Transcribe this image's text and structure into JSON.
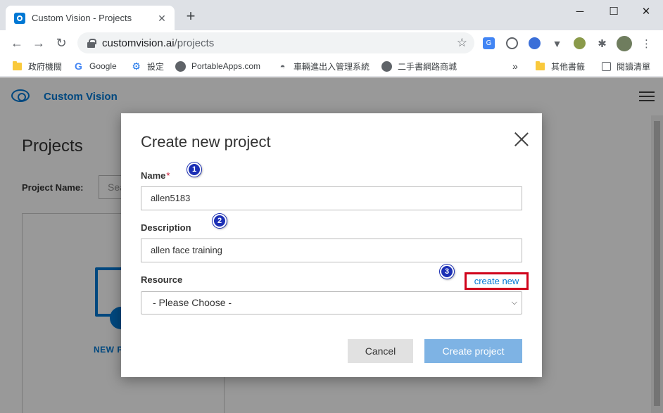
{
  "browser": {
    "tab_title": "Custom Vision - Projects",
    "tab_close_glyph": "✕",
    "new_tab_glyph": "+",
    "window_controls": {
      "minimize": "─",
      "maximize": "☐",
      "close": "✕"
    },
    "url_host": "customvision.ai",
    "url_path": "/projects",
    "nav": {
      "back": "←",
      "forward": "→",
      "reload": "↻"
    },
    "star_glyph": "☆",
    "extensions": [
      "translate-icon",
      "chat-icon",
      "compass-icon",
      "vee-icon",
      "leaf-icon",
      "puzzle-icon",
      "avatar",
      "menu-dots-icon"
    ],
    "bookmarks": [
      {
        "label": "政府機關",
        "icon": "folder-icon"
      },
      {
        "label": "Google",
        "icon": "google-icon"
      },
      {
        "label": "設定",
        "icon": "gear-icon"
      },
      {
        "label": "PortableApps.com",
        "icon": "portableapps-icon"
      },
      {
        "label": "車輛進出入管理系統",
        "icon": "car-icon"
      },
      {
        "label": "二手書網路商城",
        "icon": "globe-icon"
      }
    ],
    "bookmarks_overflow": "»",
    "other_bookmarks": "其他書籤",
    "reading_list": "閱讀清單"
  },
  "app": {
    "brand": "Custom Vision",
    "page_title": "Projects",
    "project_name_label": "Project Name:",
    "search_placeholder": "Sea",
    "new_project_label": "NEW P"
  },
  "modal": {
    "title": "Create new project",
    "name_label": "Name",
    "required_mark": "*",
    "name_value": "allen5183",
    "description_label": "Description",
    "description_value": "allen face training",
    "resource_label": "Resource",
    "create_new_link": "create new",
    "resource_select": "- Please Choose -",
    "cancel_button": "Cancel",
    "create_button": "Create project"
  },
  "annotations": [
    "1",
    "2",
    "3"
  ],
  "colors": {
    "accent": "#0078d4",
    "highlight_border": "#d0021b",
    "step_marker": "#1b2fb5",
    "create_button_disabled": "#7eb3e4"
  }
}
